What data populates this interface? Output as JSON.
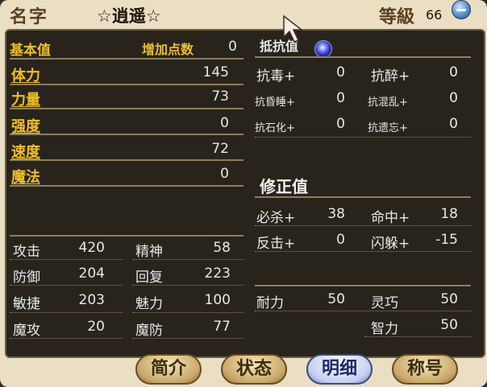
{
  "header": {
    "name_label": "名字",
    "name_value": "☆逍遥☆",
    "level_label": "等級",
    "level_value": "66"
  },
  "base": {
    "title": "基本值",
    "points_label": "增加点数",
    "points_value": "0",
    "stats": [
      {
        "label": "体力",
        "value": "145"
      },
      {
        "label": "力量",
        "value": "73"
      },
      {
        "label": "强度",
        "value": "0"
      },
      {
        "label": "速度",
        "value": "72"
      },
      {
        "label": "魔法",
        "value": "0"
      }
    ]
  },
  "combat": [
    {
      "label": "攻击",
      "value": "420",
      "label2": "精神",
      "value2": "58"
    },
    {
      "label": "防御",
      "value": "204",
      "label2": "回复",
      "value2": "223"
    },
    {
      "label": "敏捷",
      "value": "203",
      "label2": "魅力",
      "value2": "100"
    },
    {
      "label": "魔攻",
      "value": "20",
      "label2": "魔防",
      "value2": "77"
    }
  ],
  "resist": {
    "title": "抵抗值",
    "items": [
      {
        "label": "抗毒+",
        "value": "0",
        "label2": "抗醉+",
        "value2": "0"
      },
      {
        "label": "抗昏睡+",
        "value": "0",
        "label2": "抗混乱+",
        "value2": "0"
      },
      {
        "label": "抗石化+",
        "value": "0",
        "label2": "抗遗忘+",
        "value2": "0"
      }
    ]
  },
  "modifier": {
    "title": "修正值",
    "items": [
      {
        "label": "必杀+",
        "value": "38",
        "label2": "命中+",
        "value2": "18"
      },
      {
        "label": "反击+",
        "value": "0",
        "label2": "闪躲+",
        "value2": "-15"
      }
    ]
  },
  "extra": {
    "durability_label": "耐力",
    "durability_value": "50",
    "agility_label": "灵巧",
    "agility_value": "50",
    "intellect_label": "智力",
    "intellect_value": "50"
  },
  "tabs": [
    "简介",
    "状态",
    "明细",
    "称号"
  ],
  "colors": {
    "accent": "#f0c020",
    "panel": "#28241c",
    "frame": "#eadfc3"
  }
}
